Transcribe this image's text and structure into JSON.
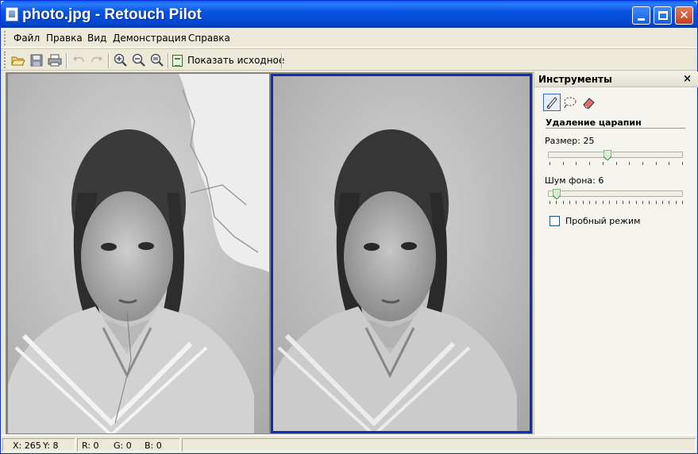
{
  "window": {
    "title": "photo.jpg - Retouch Pilot"
  },
  "menu": {
    "items": [
      "Файл",
      "Правка",
      "Вид",
      "Демонстрация",
      "Справка"
    ]
  },
  "toolbar": {
    "icons": [
      "open-icon",
      "save-icon",
      "print-icon",
      "undo-icon",
      "redo-icon",
      "zoom-in-icon",
      "zoom-out-icon",
      "zoom-fit-icon"
    ],
    "show_original_label": "Показать исходное"
  },
  "panel": {
    "title": "Инструменты",
    "close_label": "×",
    "tools": [
      "brush-icon",
      "lasso-icon",
      "eraser-icon"
    ],
    "section_title": "Удаление царапин",
    "size_label": "Размер: 25",
    "size_value": 25,
    "size_fraction": 0.44,
    "noise_label": "Шум фона: 6",
    "noise_value": 6,
    "noise_fraction": 0.06,
    "test_mode_label": "Пробный режим",
    "test_mode_checked": false
  },
  "status": {
    "x": "X: 265",
    "y": "Y: 8",
    "r": "R: 0",
    "g": "G: 0",
    "b": "B: 0"
  },
  "colors": {
    "titlebar": "#0a54e3",
    "selection": "#0a2fbf",
    "accent_thumb": "#3d8a3d"
  }
}
